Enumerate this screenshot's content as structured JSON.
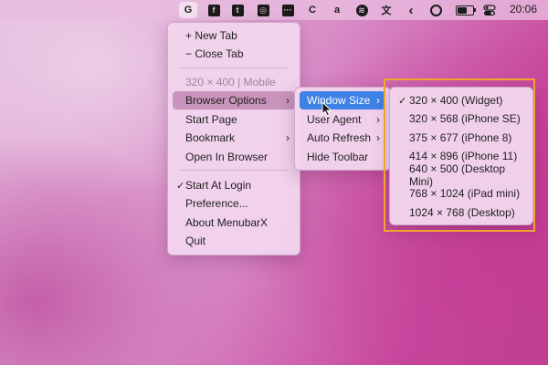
{
  "menubar": {
    "items": [
      {
        "name": "google-icon",
        "glyph": "G"
      },
      {
        "name": "facebook-icon",
        "glyph": "f"
      },
      {
        "name": "twitter-icon",
        "glyph": "t"
      },
      {
        "name": "instagram-icon",
        "glyph": "◎"
      },
      {
        "name": "app-icon",
        "glyph": "···"
      },
      {
        "name": "c-icon",
        "glyph": "C"
      },
      {
        "name": "amazon-icon",
        "glyph": "a"
      },
      {
        "name": "spotify-icon",
        "glyph": "≋"
      },
      {
        "name": "translate-icon",
        "glyph": "文"
      },
      {
        "name": "back-icon",
        "glyph": "‹"
      },
      {
        "name": "record-icon",
        "glyph": "●"
      }
    ],
    "clock": "20:06"
  },
  "main_menu": {
    "new_tab": "+ New Tab",
    "close_tab": "− Close Tab",
    "size_info": "320 × 400 | Mobile",
    "browser_options": "Browser Options",
    "start_page": "Start Page",
    "bookmark": "Bookmark",
    "open_in_browser": "Open In Browser",
    "start_at_login": "Start At Login",
    "preference": "Preference...",
    "about": "About MenubarX",
    "quit": "Quit"
  },
  "browser_options_menu": {
    "window_size": "Window Size",
    "user_agent": "User Agent",
    "auto_refresh": "Auto Refresh",
    "hide_toolbar": "Hide Toolbar"
  },
  "window_size_menu": {
    "selected": "320 × 400 (Widget)",
    "options": [
      "320 × 400 (Widget)",
      "320 × 568 (iPhone SE)",
      "375 × 677 (iPhone 8)",
      "414 × 896 (iPhone 11)",
      "640 × 500 (Desktop Mini)",
      "768 × 1024 (iPad mini)",
      "1024 × 768 (Desktop)"
    ]
  },
  "icons": {
    "chevron": "›",
    "checkmark": "✓"
  }
}
